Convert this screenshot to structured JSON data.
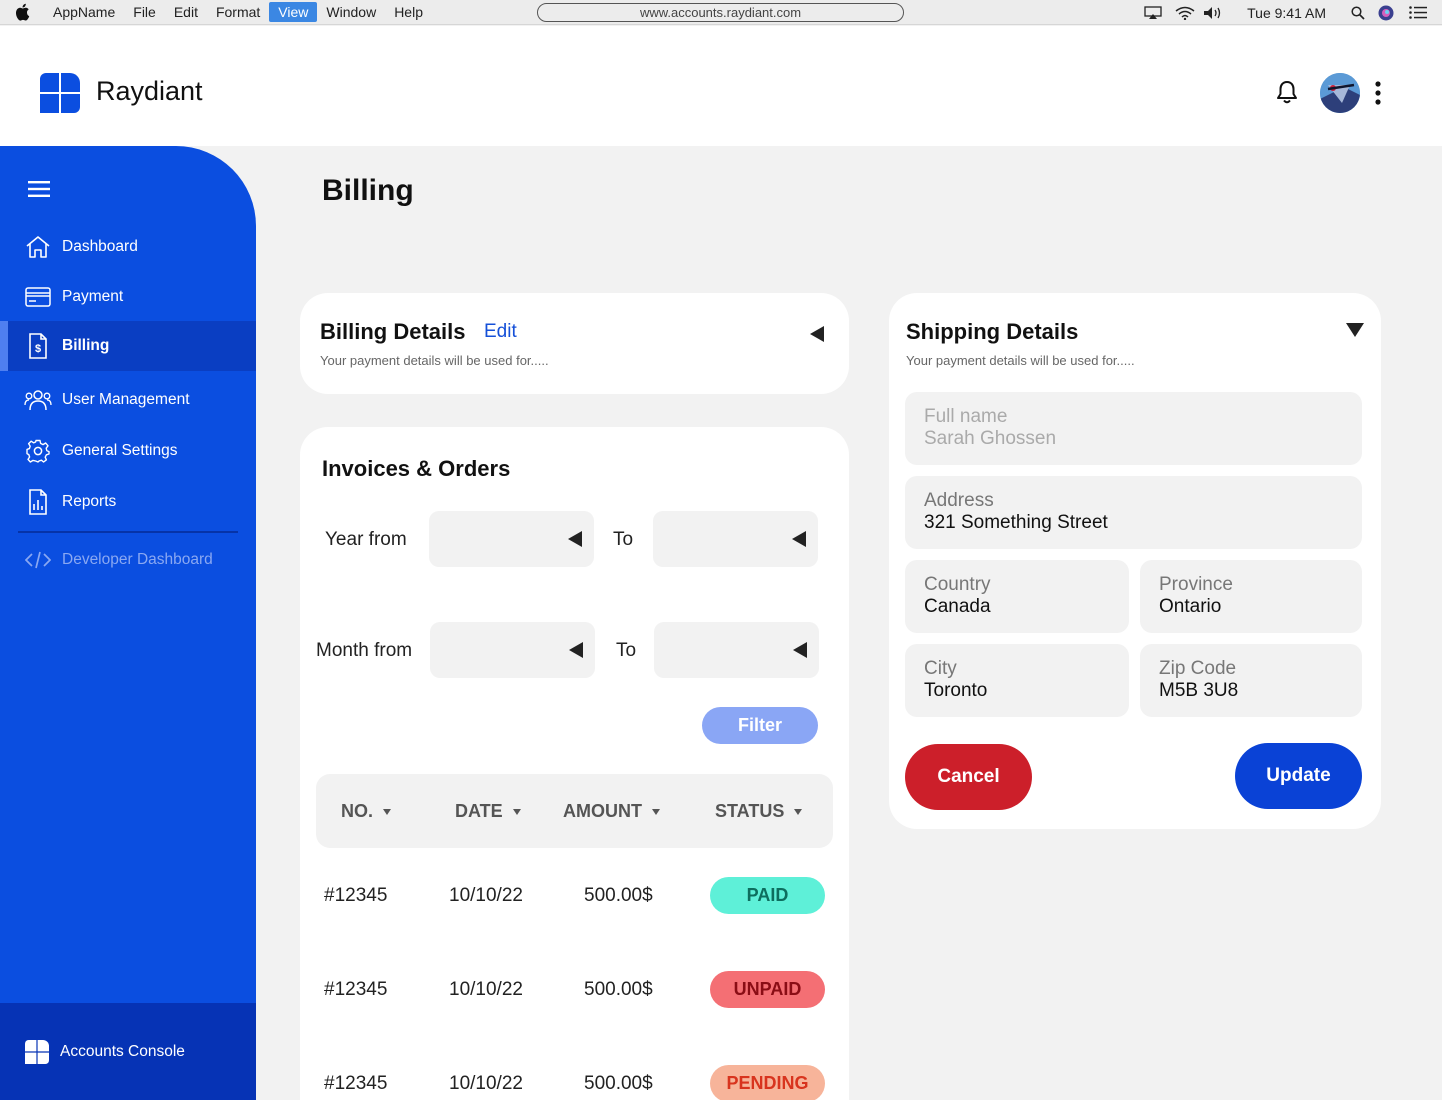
{
  "menubar": {
    "items": [
      "AppName",
      "File",
      "Edit",
      "Format",
      "View",
      "Window",
      "Help"
    ],
    "active_item": "View",
    "url": "www.accounts.raydiant.com",
    "clock": "Tue 9:41 AM"
  },
  "header": {
    "brand": "Raydiant"
  },
  "sidebar": {
    "items": [
      {
        "label": "Dashboard",
        "icon": "home-icon"
      },
      {
        "label": "Payment",
        "icon": "credit-card-icon"
      },
      {
        "label": "Billing",
        "icon": "invoice-icon",
        "active": true
      },
      {
        "label": "User Management",
        "icon": "users-icon"
      },
      {
        "label": "General Settings",
        "icon": "gear-icon"
      },
      {
        "label": "Reports",
        "icon": "report-icon"
      }
    ],
    "developer": {
      "label": "Developer Dashboard",
      "icon": "code-icon"
    },
    "console": {
      "label": "Accounts Console",
      "icon": "raydiant-logo-icon"
    }
  },
  "page": {
    "title": "Billing"
  },
  "billing_details": {
    "title": "Billing Details",
    "edit_label": "Edit",
    "subtitle": "Your payment details will be used for....."
  },
  "invoices": {
    "title": "Invoices & Orders",
    "year_from_label": "Year from",
    "year_to_label": "To",
    "month_from_label": "Month from",
    "month_to_label": "To",
    "filter_label": "Filter",
    "columns": [
      "NO.",
      "DATE",
      "AMOUNT",
      "STATUS"
    ],
    "rows": [
      {
        "no": "#12345",
        "date": "10/10/22",
        "amount": "500.00$",
        "status": "PAID"
      },
      {
        "no": "#12345",
        "date": "10/10/22",
        "amount": "500.00$",
        "status": "UNPAID"
      },
      {
        "no": "#12345",
        "date": "10/10/22",
        "amount": "500.00$",
        "status": "PENDING"
      }
    ]
  },
  "shipping": {
    "title": "Shipping Details",
    "subtitle": "Your payment details will be used for.....",
    "full_name_label": "Full name",
    "full_name_value": "Sarah Ghossen",
    "address_label": "Address",
    "address_value": "321 Something Street",
    "country_label": "Country",
    "country_value": "Canada",
    "province_label": "Province",
    "province_value": "Ontario",
    "city_label": "City",
    "city_value": "Toronto",
    "zip_label": "Zip Code",
    "zip_value": "M5B 3U8",
    "cancel_label": "Cancel",
    "update_label": "Update"
  },
  "colors": {
    "sidebar": "#0b4ee0",
    "sidebar_active": "#0a3ec2",
    "paid_bg": "#5ef0d8",
    "paid_text": "#0d6e5e",
    "unpaid_bg": "#f46f74",
    "unpaid_text": "#8a0d15",
    "pending_bg": "#f7b49a",
    "pending_text": "#d8341e",
    "cancel": "#cc1f2a",
    "update": "#0a42d6"
  }
}
